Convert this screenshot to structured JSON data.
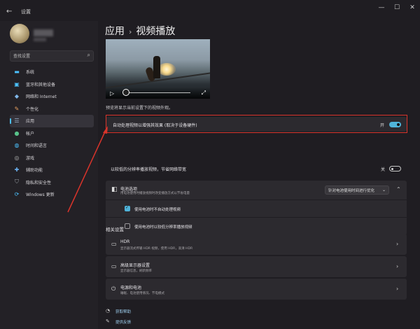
{
  "window": {
    "title": "设置",
    "controls": [
      "minimize-icon",
      "maximize-icon",
      "close-icon"
    ]
  },
  "sidebar": {
    "search_placeholder": "查找设置",
    "items": [
      {
        "label": "系统",
        "icon": "monitor-icon",
        "color": "#4cc2ff"
      },
      {
        "label": "蓝牙和其他设备",
        "icon": "bluetooth-icon",
        "color": "#4cc2ff"
      },
      {
        "label": "网络和 Internet",
        "icon": "wifi-icon",
        "color": "#7fb6e8"
      },
      {
        "label": "个性化",
        "icon": "brush-icon",
        "color": "#e8a060"
      },
      {
        "label": "应用",
        "icon": "apps-icon",
        "color": "#9ab0c8",
        "active": true
      },
      {
        "label": "帐户",
        "icon": "person-icon",
        "color": "#58c28a"
      },
      {
        "label": "时间和语言",
        "icon": "globe-clock-icon",
        "color": "#4cc2ff"
      },
      {
        "label": "游戏",
        "icon": "gamepad-icon",
        "color": "#b0b0b0"
      },
      {
        "label": "辅助功能",
        "icon": "accessibility-icon",
        "color": "#6ab0f0"
      },
      {
        "label": "隐私和安全性",
        "icon": "shield-icon",
        "color": "#9aa0a6"
      },
      {
        "label": "Windows 更新",
        "icon": "update-icon",
        "color": "#4cc2ff"
      }
    ]
  },
  "main": {
    "breadcrumb": {
      "parent": "应用",
      "separator": "›",
      "current": "视频播放"
    },
    "preview_caption": "预览将显示当前设置下的视频外观。",
    "auto_process": {
      "label": "自动处理视频以增强其效果 (取决于设备硬件)",
      "state": "开",
      "on": true
    },
    "low_res": {
      "label": "以较低的分辨率播放视频，节省网络带宽",
      "state": "关",
      "on": false
    },
    "battery": {
      "title": "电池选项",
      "subtitle": "用电池使用时播放视频时改变播放方式以节省电量",
      "dropdown": "针对电池使用时间进行优化",
      "option1": {
        "label": "使用电池时不自动处理视频",
        "checked": true
      },
      "option2": {
        "label": "使用电池时以较低分辨率播放视频",
        "checked": false
      }
    },
    "related_title": "相关设置",
    "related": [
      {
        "title": "HDR",
        "subtitle": "显示器流式传输 HDR 视频，使用 HDR，高清 HDR",
        "icon": "hdr-icon"
      },
      {
        "title": "高级显示器设置",
        "subtitle": "显示器信息，刷新频率",
        "icon": "monitor-icon"
      },
      {
        "title": "电源和电池",
        "subtitle": "睡眠、电池使用情况、节电模式",
        "icon": "power-icon"
      }
    ],
    "links": [
      {
        "label": "获取帮助",
        "icon": "help-icon"
      },
      {
        "label": "提供反馈",
        "icon": "feedback-icon"
      }
    ]
  }
}
